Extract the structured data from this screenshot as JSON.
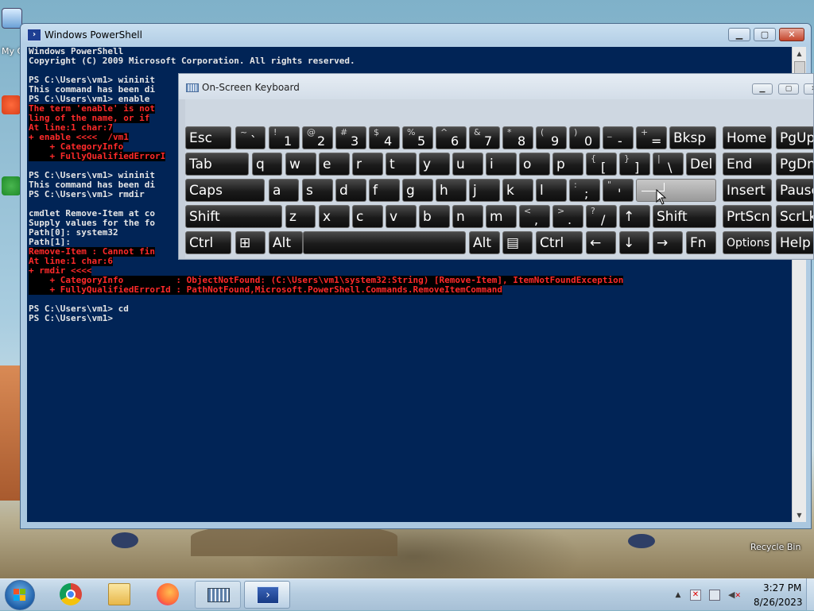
{
  "desktop": {
    "my_computer_label": "My C",
    "recycle_bin_label": "Recycle Bin"
  },
  "powershell": {
    "title": "Windows PowerShell",
    "lines": [
      {
        "text": "Windows PowerShell",
        "err": false
      },
      {
        "text": "Copyright (C) 2009 Microsoft Corporation. All rights reserved.",
        "err": false
      },
      {
        "text": "",
        "err": false
      },
      {
        "text": "PS C:\\Users\\vm1> wininit",
        "err": false
      },
      {
        "text": "This command has been di",
        "err": false
      },
      {
        "text": "PS C:\\Users\\vm1> enable",
        "err": false
      },
      {
        "text": "The term 'enable' is not",
        "err": true
      },
      {
        "text": "ling of the name, or if",
        "err": true
      },
      {
        "text": "At line:1 char:7",
        "err": true
      },
      {
        "text": "+ enable <<<<  /vm1",
        "err": true
      },
      {
        "text": "    + CategoryInfo",
        "err": true
      },
      {
        "text": "    + FullyQualifiedErrorI",
        "err": true
      },
      {
        "text": "",
        "err": false
      },
      {
        "text": "PS C:\\Users\\vm1> wininit",
        "err": false
      },
      {
        "text": "This command has been di",
        "err": false
      },
      {
        "text": "PS C:\\Users\\vm1> rmdir",
        "err": false
      },
      {
        "text": "",
        "err": false
      },
      {
        "text": "cmdlet Remove-Item at co",
        "err": false
      },
      {
        "text": "Supply values for the fo",
        "err": false
      },
      {
        "text": "Path[0]: system32",
        "err": false
      },
      {
        "text": "Path[1]:",
        "err": false
      },
      {
        "text": "Remove-Item : Cannot fin",
        "err": true
      },
      {
        "text": "At line:1 char:6",
        "err": true
      },
      {
        "text": "+ rmdir <<<<",
        "err": true
      },
      {
        "text": "    + CategoryInfo          : ObjectNotFound: (C:\\Users\\vm1\\system32:String) [Remove-Item], ItemNotFoundException",
        "err": true
      },
      {
        "text": "    + FullyQualifiedErrorId : PathNotFound,Microsoft.PowerShell.Commands.RemoveItemCommand",
        "err": true
      },
      {
        "text": "",
        "err": false
      },
      {
        "text": "PS C:\\Users\\vm1> cd",
        "err": false
      },
      {
        "text": "PS C:\\Users\\vm1>",
        "err": false
      }
    ]
  },
  "osk": {
    "title": "On-Screen Keyboard",
    "rows": [
      [
        {
          "n": "esc",
          "l": "Esc"
        },
        {
          "n": "backtick",
          "s": "~",
          "m": "`"
        },
        {
          "n": "1",
          "s": "!",
          "m": "1"
        },
        {
          "n": "2",
          "s": "@",
          "m": "2"
        },
        {
          "n": "3",
          "s": "#",
          "m": "3"
        },
        {
          "n": "4",
          "s": "$",
          "m": "4"
        },
        {
          "n": "5",
          "s": "%",
          "m": "5"
        },
        {
          "n": "6",
          "s": "^",
          "m": "6"
        },
        {
          "n": "7",
          "s": "&",
          "m": "7"
        },
        {
          "n": "8",
          "s": "*",
          "m": "8"
        },
        {
          "n": "9",
          "s": "(",
          "m": "9"
        },
        {
          "n": "0",
          "s": ")",
          "m": "0"
        },
        {
          "n": "minus",
          "s": "_",
          "m": "-"
        },
        {
          "n": "equals",
          "s": "+",
          "m": "="
        },
        {
          "n": "bksp",
          "l": "Bksp"
        },
        {
          "n": "home",
          "l": "Home"
        },
        {
          "n": "pgup",
          "l": "PgUp"
        }
      ],
      [
        {
          "n": "tab",
          "l": "Tab"
        },
        {
          "n": "q",
          "l": "q"
        },
        {
          "n": "w",
          "l": "w"
        },
        {
          "n": "e",
          "l": "e"
        },
        {
          "n": "r",
          "l": "r"
        },
        {
          "n": "t",
          "l": "t"
        },
        {
          "n": "y",
          "l": "y"
        },
        {
          "n": "u",
          "l": "u"
        },
        {
          "n": "i",
          "l": "i"
        },
        {
          "n": "o",
          "l": "o"
        },
        {
          "n": "p",
          "l": "p"
        },
        {
          "n": "lbracket",
          "s": "{",
          "m": "["
        },
        {
          "n": "rbracket",
          "s": "}",
          "m": "]"
        },
        {
          "n": "backslash",
          "s": "|",
          "m": "\\"
        },
        {
          "n": "del",
          "l": "Del"
        },
        {
          "n": "end",
          "l": "End"
        },
        {
          "n": "pgdn",
          "l": "PgDn"
        }
      ],
      [
        {
          "n": "caps",
          "l": "Caps"
        },
        {
          "n": "a",
          "l": "a"
        },
        {
          "n": "s",
          "l": "s"
        },
        {
          "n": "d",
          "l": "d"
        },
        {
          "n": "f",
          "l": "f"
        },
        {
          "n": "g",
          "l": "g"
        },
        {
          "n": "h",
          "l": "h"
        },
        {
          "n": "j",
          "l": "j"
        },
        {
          "n": "k",
          "l": "k"
        },
        {
          "n": "l",
          "l": "l"
        },
        {
          "n": "semicolon",
          "s": ":",
          "m": ";"
        },
        {
          "n": "quote",
          "s": "\"",
          "m": "'"
        },
        {
          "n": "enter",
          "l": "",
          "enter": true
        },
        {
          "n": "insert",
          "l": "Insert"
        },
        {
          "n": "pause",
          "l": "Pause"
        }
      ],
      [
        {
          "n": "lshift",
          "l": "Shift"
        },
        {
          "n": "z",
          "l": "z"
        },
        {
          "n": "x",
          "l": "x"
        },
        {
          "n": "c",
          "l": "c"
        },
        {
          "n": "v",
          "l": "v"
        },
        {
          "n": "b",
          "l": "b"
        },
        {
          "n": "n",
          "l": "n"
        },
        {
          "n": "m",
          "l": "m"
        },
        {
          "n": "comma",
          "s": "<",
          "m": ","
        },
        {
          "n": "period",
          "s": ">",
          "m": "."
        },
        {
          "n": "slash",
          "s": "?",
          "m": "/"
        },
        {
          "n": "up",
          "l": "↑"
        },
        {
          "n": "rshift",
          "l": "Shift"
        },
        {
          "n": "prtscn",
          "l": "PrtScn"
        },
        {
          "n": "scrlk",
          "l": "ScrLk"
        }
      ],
      [
        {
          "n": "lctrl",
          "l": "Ctrl"
        },
        {
          "n": "win",
          "l": "⊞"
        },
        {
          "n": "lalt",
          "l": "Alt"
        },
        {
          "n": "space",
          "l": ""
        },
        {
          "n": "ralt",
          "l": "Alt"
        },
        {
          "n": "menu",
          "l": "▤"
        },
        {
          "n": "rctrl",
          "l": "Ctrl"
        },
        {
          "n": "left",
          "l": "←"
        },
        {
          "n": "down",
          "l": "↓"
        },
        {
          "n": "right",
          "l": "→"
        },
        {
          "n": "fn",
          "l": "Fn"
        },
        {
          "n": "options",
          "l": "Options"
        },
        {
          "n": "help",
          "l": "Help"
        }
      ]
    ]
  },
  "taskbar": {
    "items": [
      "chrome",
      "explorer",
      "firefox",
      "osk",
      "powershell"
    ],
    "clock_time": "3:27 PM",
    "clock_date": "8/26/2023"
  }
}
